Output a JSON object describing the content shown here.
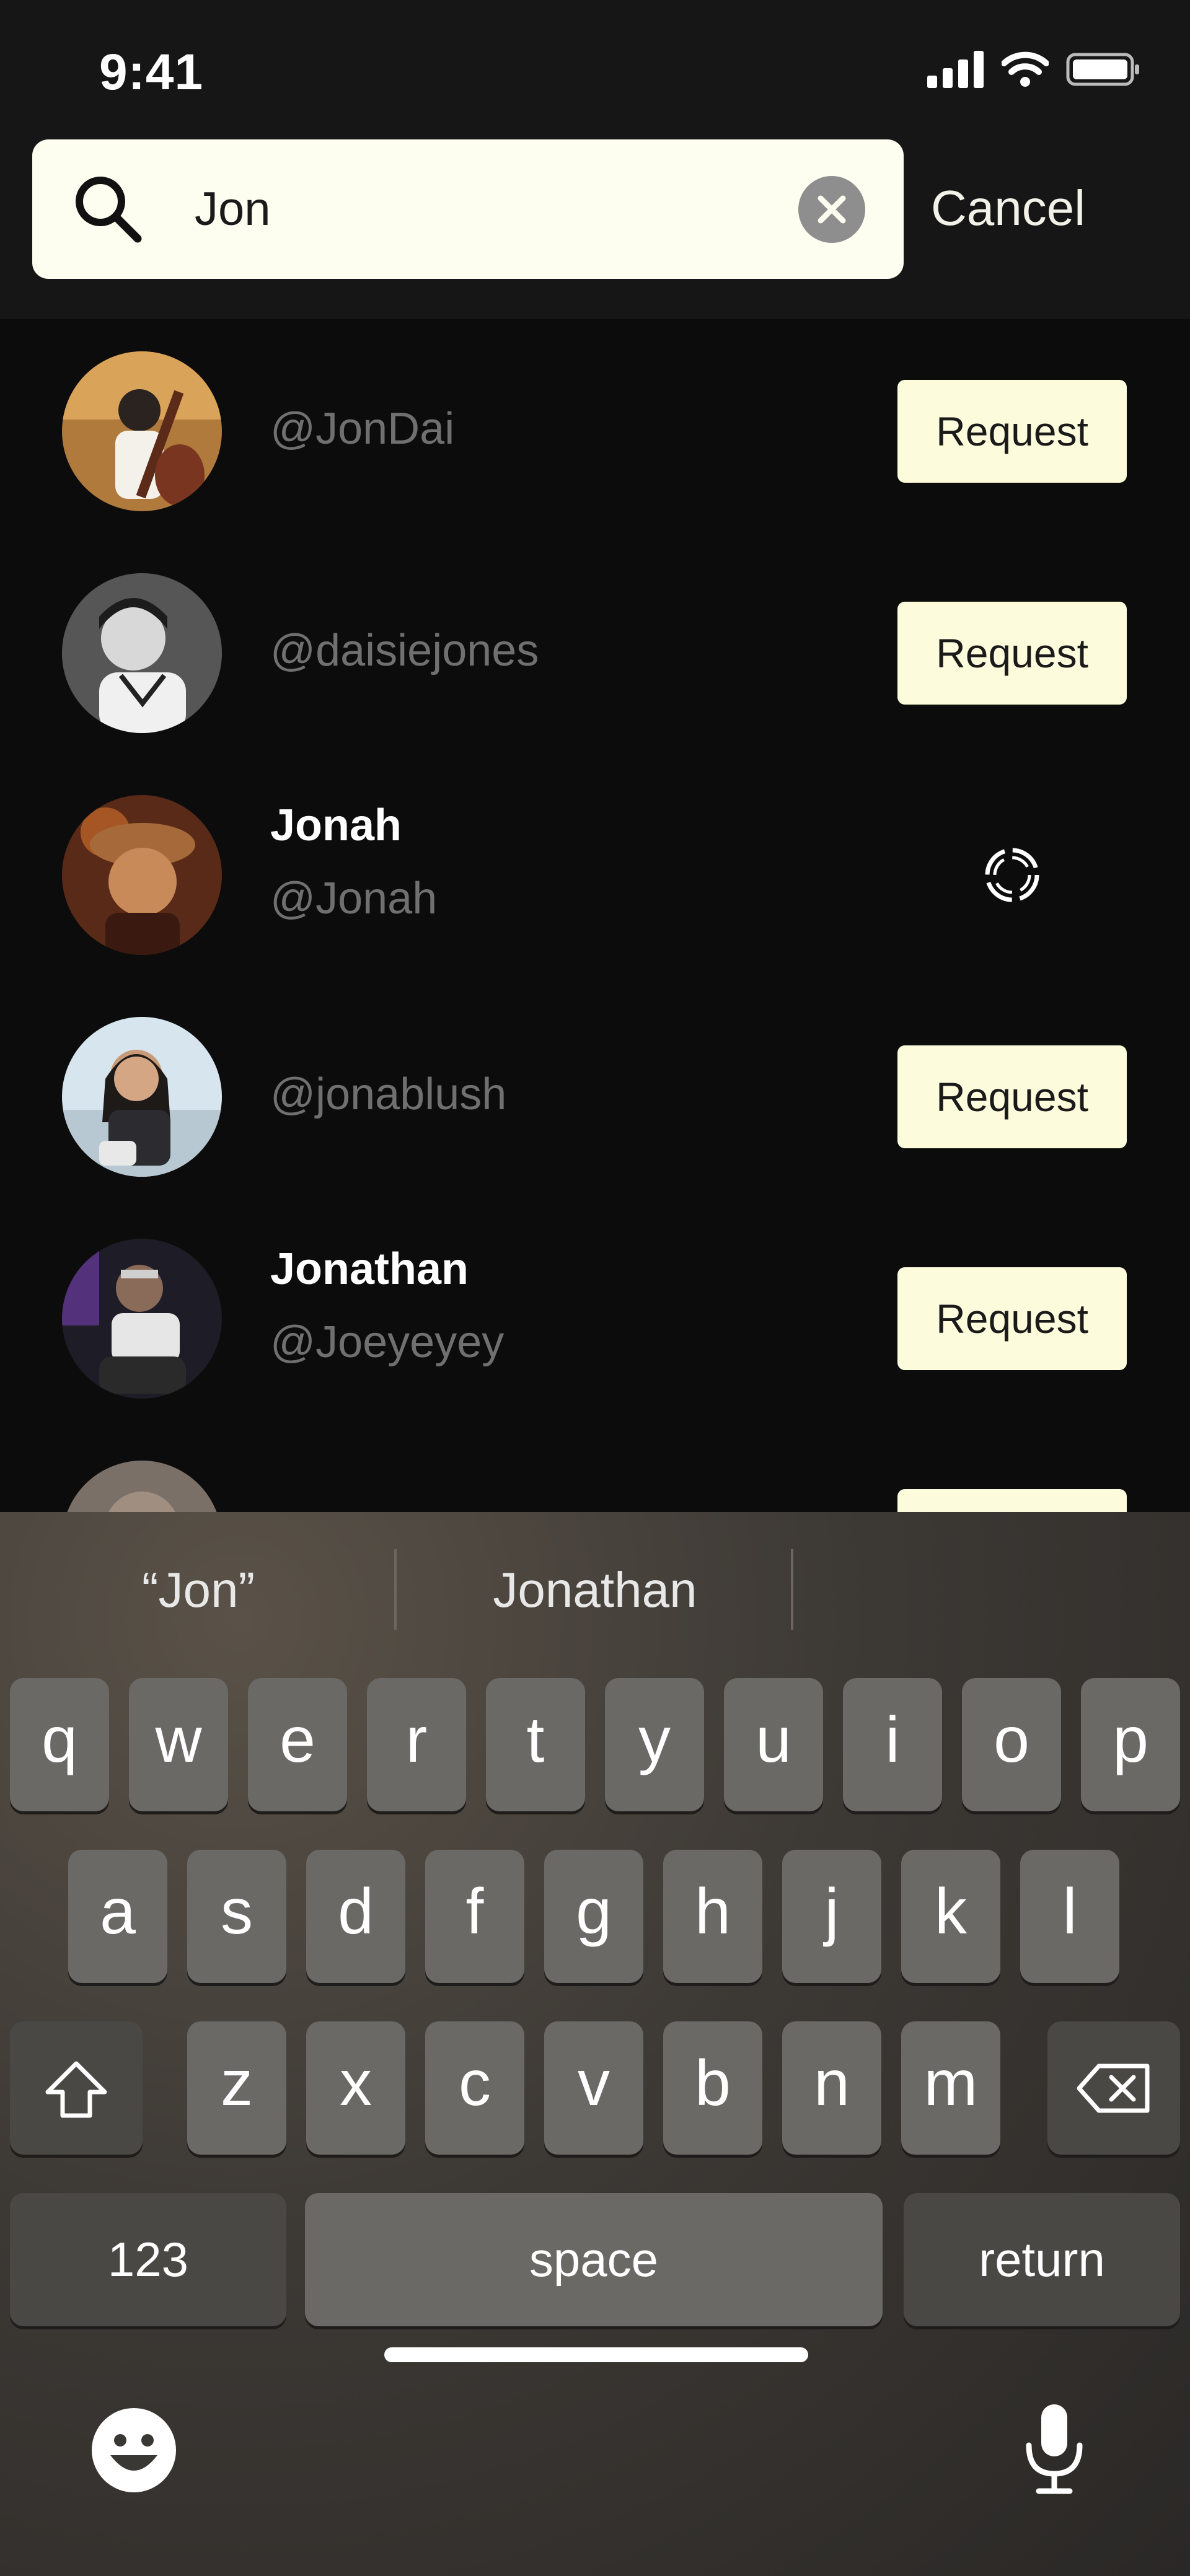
{
  "status": {
    "time": "9:41"
  },
  "search": {
    "value": "Jon",
    "cancel_label": "Cancel"
  },
  "results": [
    {
      "name": "",
      "handle": "@JonDai",
      "action": "Request"
    },
    {
      "name": "",
      "handle": "@daisiejones",
      "action": "Request"
    },
    {
      "name": "Jonah",
      "handle": "@Jonah",
      "action": ""
    },
    {
      "name": "",
      "handle": "@jonablush",
      "action": "Request"
    },
    {
      "name": "Jonathan",
      "handle": "@Joeyeyey",
      "action": "Request"
    }
  ],
  "keyboard": {
    "suggestions": [
      "“Jon”",
      "Jonathan",
      ""
    ],
    "row1": [
      "q",
      "w",
      "e",
      "r",
      "t",
      "y",
      "u",
      "i",
      "o",
      "p"
    ],
    "row2": [
      "a",
      "s",
      "d",
      "f",
      "g",
      "h",
      "j",
      "k",
      "l"
    ],
    "row3": [
      "z",
      "x",
      "c",
      "v",
      "b",
      "n",
      "m"
    ],
    "numbers_label": "123",
    "space_label": "space",
    "return_label": "return"
  },
  "icons": {
    "search": "search-icon",
    "clear": "clear-icon",
    "spinner": "loading-spinner-icon",
    "shift": "shift-icon",
    "delete": "delete-icon",
    "emoji": "emoji-icon",
    "mic": "microphone-icon",
    "signal": "signal-icon",
    "wifi": "wifi-icon",
    "battery": "battery-icon"
  },
  "colors": {
    "accent": "#fcfbdc",
    "background": "#0c0c0c",
    "search_field": "#fdfdf0"
  }
}
